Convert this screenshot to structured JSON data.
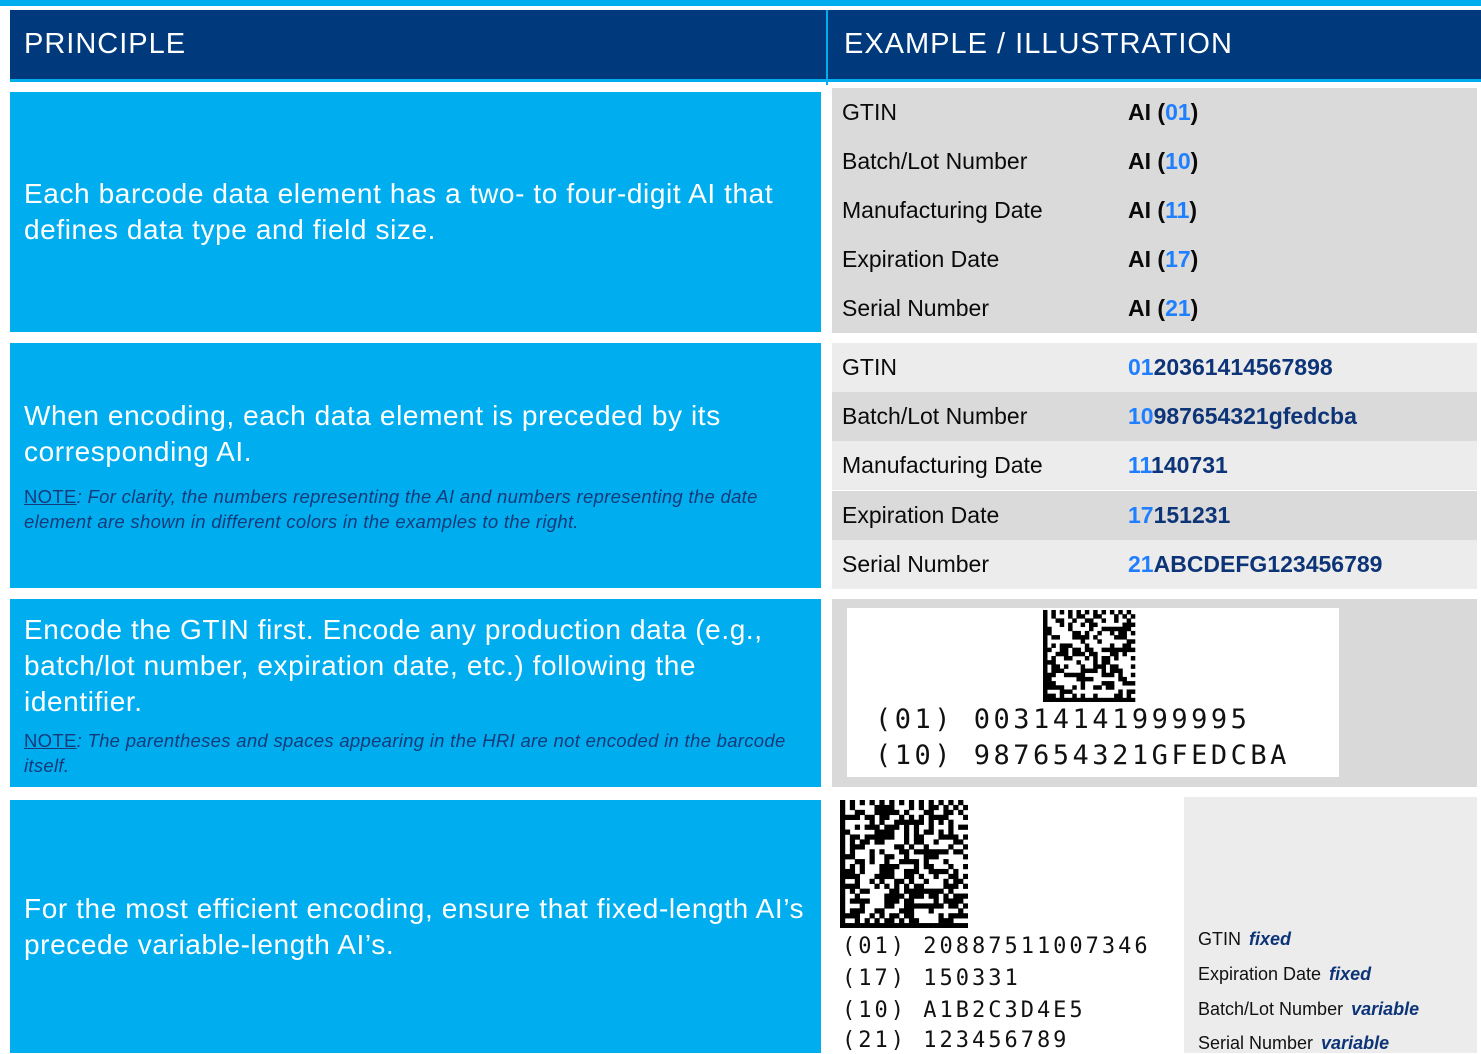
{
  "header": {
    "left": "PRINCIPLE",
    "right": "EXAMPLE / ILLUSTRATION"
  },
  "rows": [
    {
      "principle": "Each barcode data element has a two- to four-digit AI that defines data type and field size.",
      "examples": [
        {
          "label": "GTIN",
          "prefix": "AI (",
          "ai": "01",
          "suffix": ")"
        },
        {
          "label": "Batch/Lot Number",
          "prefix": "AI (",
          "ai": "10",
          "suffix": ")"
        },
        {
          "label": "Manufacturing Date",
          "prefix": "AI (",
          "ai": "11",
          "suffix": ")"
        },
        {
          "label": "Expiration Date",
          "prefix": "AI (",
          "ai": "17",
          "suffix": ")"
        },
        {
          "label": "Serial Number",
          "prefix": "AI (",
          "ai": "21",
          "suffix": ")"
        }
      ]
    },
    {
      "principle": "When encoding, each data element is preceded by its corresponding AI.",
      "note_label": "NOTE",
      "note_text": ":  For clarity, the numbers representing the AI and numbers representing the date element are shown in different colors in the examples to the right.",
      "examples": [
        {
          "label": "GTIN",
          "ai": "01",
          "value": "20361414567898"
        },
        {
          "label": "Batch/Lot Number",
          "ai": "10",
          "value": "987654321gfedcba"
        },
        {
          "label": "Manufacturing Date",
          "ai": "11",
          "value": "140731"
        },
        {
          "label": "Expiration Date",
          "ai": "17",
          "value": "151231"
        },
        {
          "label": "Serial Number",
          "ai": "21",
          "value": "ABCDEFG123456789"
        }
      ]
    },
    {
      "principle": "Encode the GTIN first.  Encode any production data (e.g., batch/lot number, expiration date, etc.) following the identifier.",
      "note_label": "NOTE",
      "note_text": ":  The parentheses and spaces appearing in the HRI are not encoded in the barcode itself.",
      "hri": [
        "(01) 00314141999995",
        "(10) 987654321GFEDCBA"
      ]
    },
    {
      "principle": "For the most efficient encoding, ensure that fixed-length AI’s precede variable-length AI’s.",
      "hri": [
        "(01) 20887511007346",
        "(17) 150331",
        "(10) A1B2C3D4E5",
        "(21) 123456789"
      ],
      "legend": [
        {
          "label": "GTIN",
          "type": "fixed"
        },
        {
          "label": "Expiration Date",
          "type": "fixed"
        },
        {
          "label": "Batch/Lot Number",
          "type": "variable"
        },
        {
          "label": "Serial Number",
          "type": "variable"
        }
      ]
    }
  ],
  "colors": {
    "header_bg": "#003a7d",
    "principle_bg": "#00aeef",
    "ai_blue": "#1f7fff",
    "value_navy": "#0e3478"
  }
}
